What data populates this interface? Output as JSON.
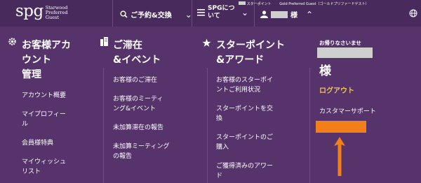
{
  "brand": {
    "logo_text": "spg",
    "logo_sub": "Starwood\nPreferred\nGuest",
    "color_bg": "#56346b",
    "color_topbar": "#482a5c",
    "color_accent": "#f37f1a",
    "color_link": "#f0c060"
  },
  "topbar": {
    "reservations_label": "ご予約&交換",
    "reservations_icon": "search-icon",
    "about_label": "SPGについて",
    "about_icon": "hamburger-menu-icon",
    "user_suffix": "様",
    "user_icon": "user-icon",
    "globe_icon": "globe-icon",
    "starpoints_label": "スターポイント",
    "member_level": "Gold Preferred Guest（ゴールドプリファードゲスト）"
  },
  "columns": [
    {
      "icon": "gear-icon",
      "title": "お客様アカ\nウント\n管理",
      "items": [
        "アカウント概要",
        "マイプロフィー\nル",
        "会員様特典",
        "マイウィッシュ\nリスト"
      ]
    },
    {
      "icon": "building-icon",
      "title": "ご滞在\n&イベント",
      "items": [
        "お客様のご滞在",
        "お客様のミーティ\nング&イベント",
        "未加算滞在の報告",
        "未加算ミーティング\nの報告"
      ]
    },
    {
      "icon": "star-icon",
      "title": "スターポイント\n&アワード",
      "items": [
        "お客様のスターポイ\nントご利用状況",
        "スターポイントを交\n換",
        "スターポイントのご\n購入",
        "ご獲得済みのアワー\nド"
      ]
    }
  ],
  "account_panel": {
    "welcome": "お帰りなさいませ",
    "name_suffix": "様",
    "logout_label": "ログアウト",
    "support_label": "カスタマーサポート"
  }
}
